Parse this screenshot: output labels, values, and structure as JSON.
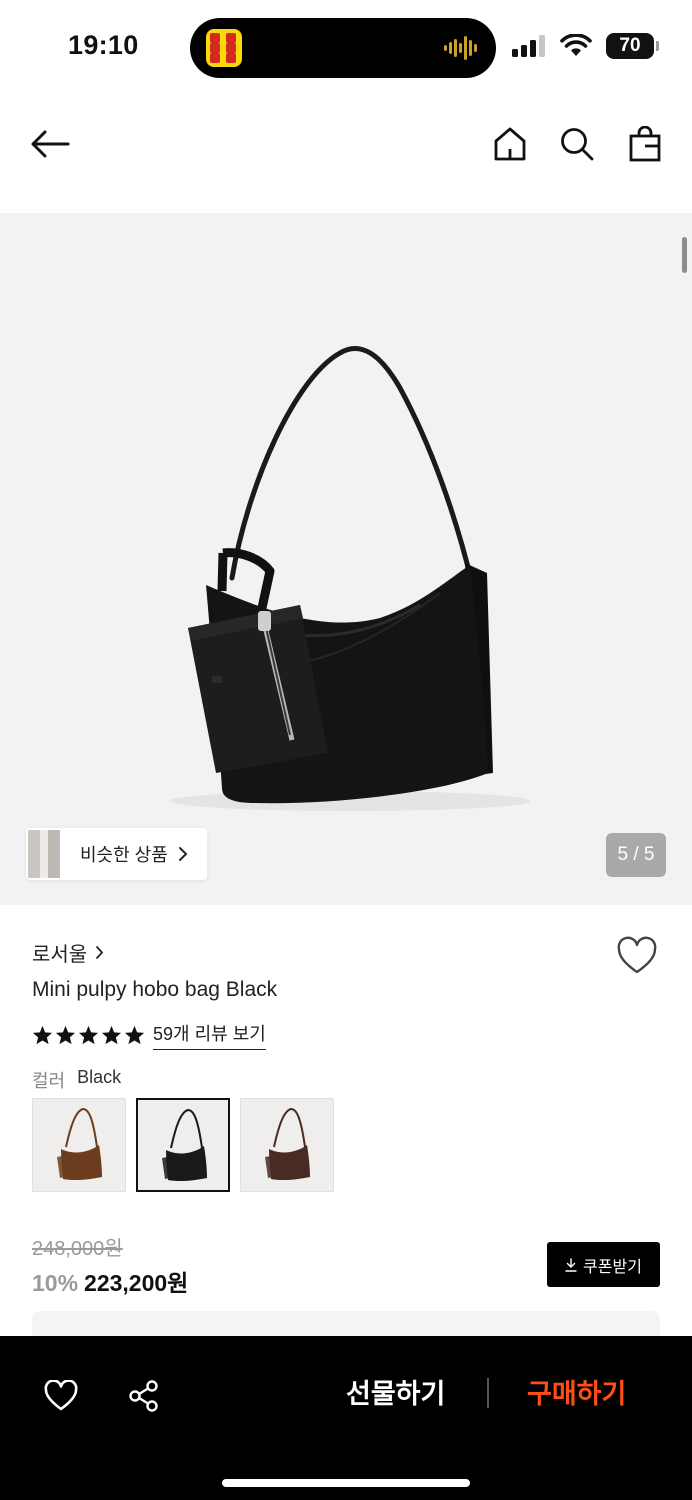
{
  "status_bar": {
    "time": "19:10",
    "battery": "70",
    "icons": [
      "cellular-signal-icon",
      "wifi-icon",
      "battery-icon"
    ]
  },
  "nav": {
    "icons": [
      "back-arrow-icon",
      "home-icon",
      "search-icon",
      "shopping-bag-icon"
    ]
  },
  "gallery": {
    "similar_products_label": "비슷한 상품",
    "page_indicator": "5 / 5"
  },
  "product": {
    "brand": "로서울",
    "name": "Mini pulpy hobo bag Black",
    "rating_stars": 5,
    "review_link": "59개 리뷰 보기",
    "color_label": "컬러",
    "color_value": "Black",
    "color_options": [
      {
        "name": "brown",
        "hex": "#6b3d1e",
        "selected": false
      },
      {
        "name": "black",
        "hex": "#1a1a1a",
        "selected": true
      },
      {
        "name": "dark-brown",
        "hex": "#4a2a24",
        "selected": false
      }
    ],
    "original_price": "248,000원",
    "discount_rate": "10%",
    "sale_price": "223,200원",
    "coupon_button": "쿠폰받기"
  },
  "bottom_bar": {
    "gift_button": "선물하기",
    "buy_button": "구매하기",
    "buy_color": "#ff4f17",
    "icons": [
      "heart-icon",
      "share-icon"
    ]
  }
}
